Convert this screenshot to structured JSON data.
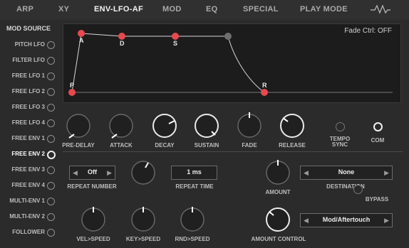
{
  "tabs": [
    {
      "label": "ARP"
    },
    {
      "label": "XY"
    },
    {
      "label": "ENV-LFO-AF",
      "active": true
    },
    {
      "label": "MOD"
    },
    {
      "label": "EQ"
    },
    {
      "label": "SPECIAL"
    },
    {
      "label": "PLAY MODE"
    }
  ],
  "sidebar": {
    "title": "MOD SOURCE",
    "items": [
      {
        "label": "PITCH LFO"
      },
      {
        "label": "FILTER LFO"
      },
      {
        "label": "FREE LFO 1"
      },
      {
        "label": "FREE LFO 2"
      },
      {
        "label": "FREE LFO 3"
      },
      {
        "label": "FREE LFO 4"
      },
      {
        "label": "FREE ENV 1"
      },
      {
        "label": "FREE ENV 2",
        "active": true
      },
      {
        "label": "FREE ENV 3"
      },
      {
        "label": "FREE ENV 4"
      },
      {
        "label": "MULTI-ENV 1"
      },
      {
        "label": "MULTI-ENV 2"
      },
      {
        "label": "FOLLOWER"
      }
    ]
  },
  "envelope": {
    "fade_ctrl": "Fade Ctrl: OFF",
    "points": {
      "p": "P",
      "a": "A",
      "d": "D",
      "s": "S",
      "r": "R"
    }
  },
  "knobs": {
    "pre_delay": "PRE-DELAY",
    "attack": "ATTACK",
    "decay": "DECAY",
    "sustain": "SUSTAIN",
    "fade": "FADE",
    "release": "RELEASE",
    "tempo_sync": "TEMPO\nSYNC",
    "com": "COM"
  },
  "repeat": {
    "number_value": "Off",
    "number_label": "REPEAT NUMBER",
    "time_value": "1 ms",
    "time_label": "REPEAT TIME"
  },
  "amount": {
    "label": "AMOUNT",
    "destination_value": "None",
    "destination_label": "DESTINATION",
    "bypass_label": "BYPASS"
  },
  "speed": {
    "vel": "VEL>SPEED",
    "key": "KEY>SPEED",
    "rnd": "RND>SPEED"
  },
  "amount_control": {
    "label": "AMOUNT CONTROL",
    "value": "Mod/Aftertouch"
  },
  "colors": {
    "accent": "#e8484f",
    "background": "#2b2b2b",
    "panel": "#1c1c1c"
  }
}
